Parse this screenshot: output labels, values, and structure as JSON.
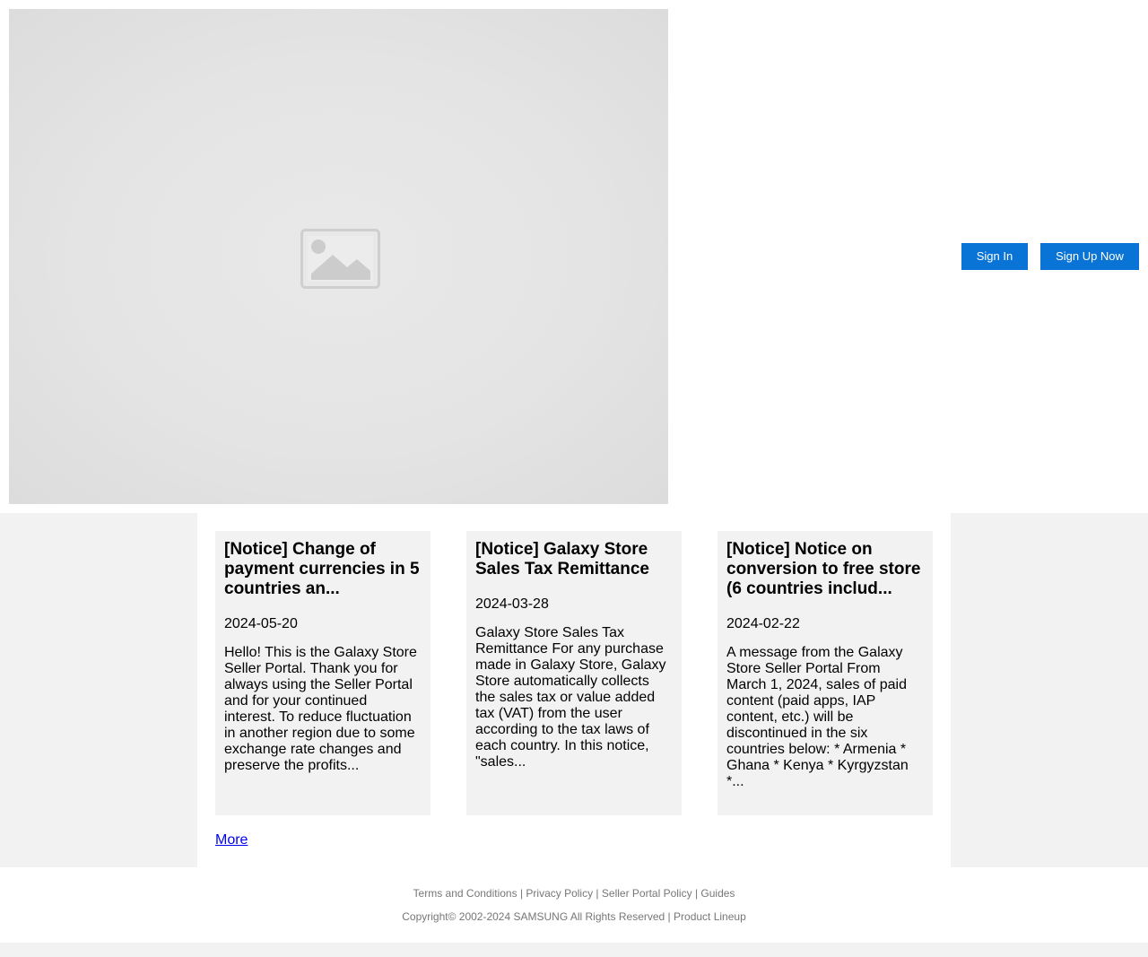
{
  "header": {
    "sign_in_label": "Sign In",
    "sign_up_label": "Sign Up Now",
    "accent_color": "#0a74d6"
  },
  "hero": {
    "icon": "image-placeholder-icon"
  },
  "notices": {
    "items": [
      {
        "title": "[Notice] Change of payment currencies in 5 countries an...",
        "date": "2024-05-20",
        "summary": "Hello! This is the Galaxy Store Seller Portal. Thank you for always using the Seller Portal and for your continued interest. To reduce fluctuation in another region due to some exchange rate changes and preserve the profits..."
      },
      {
        "title": "[Notice] Galaxy Store Sales Tax Remittance",
        "date": "2024-03-28",
        "summary": "Galaxy Store Sales Tax Remittance For any purchase made in Galaxy Store, Galaxy Store automatically collects the sales tax or value added tax (VAT) from the user according to the tax laws of each country. In this notice, \"sales..."
      },
      {
        "title": "[Notice] Notice on conversion to free store (6 countries includ...",
        "date": "2024-02-22",
        "summary": "A message from the Galaxy Store Seller Portal From March 1, 2024, sales of paid content (paid apps, IAP content, etc.) will be discontinued in the six countries below: * Armenia * Ghana * Kenya * Kyrgyzstan *..."
      }
    ],
    "more_label": "More"
  },
  "footer": {
    "links": [
      "Terms and Conditions",
      "Privacy Policy",
      "Seller Portal Policy",
      "Guides"
    ],
    "separator": " | ",
    "copyright": "Copyright© 2002-2024 SAMSUNG All Rights Reserved",
    "product_lineup": "Product Lineup"
  }
}
